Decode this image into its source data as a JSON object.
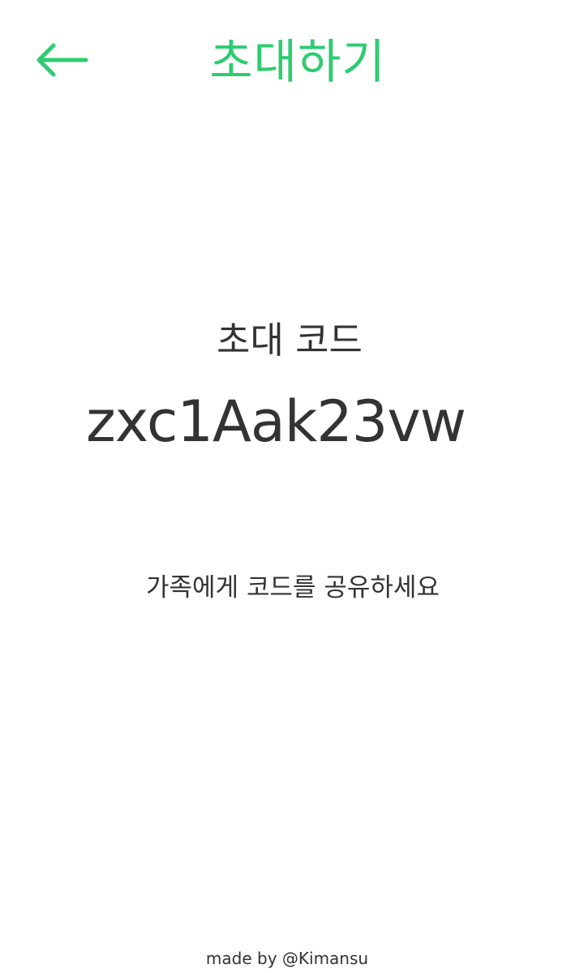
{
  "theme": {
    "accent": "#2ecc71",
    "text": "#333333",
    "background": "#ffffff"
  },
  "header": {
    "back_icon": "arrow-left-icon",
    "title": "초대하기"
  },
  "invite": {
    "label": "초대 코드",
    "code": "zxc1Aak23vw",
    "share_hint": "가족에게 코드를 공유하세요"
  },
  "footer": {
    "credit": "made by @Kimansu"
  }
}
